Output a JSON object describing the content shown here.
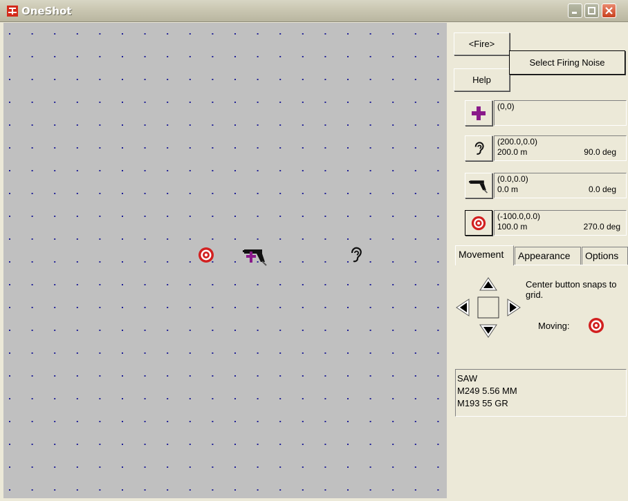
{
  "window": {
    "title": "OneShot"
  },
  "icons": {
    "app": "oneshot-app-icon",
    "crosshair": "crosshair-icon",
    "ear": "ear-icon",
    "gun": "gun-icon",
    "target": "target-icon"
  },
  "colors": {
    "grid_bg": "#c0c0c0",
    "grid_dot": "#1e1e96",
    "target_red": "#d22020",
    "crosshair_purple": "#8a1a8a"
  },
  "toolbar": {
    "fire_label": "<Fire>",
    "help_label": "Help",
    "noise_label": "Select Firing Noise"
  },
  "positions": {
    "origin": {
      "coords": "(0,0)"
    },
    "listener": {
      "coords": "(200.0,0.0)",
      "distance": "200.0 m",
      "angle": "90.0 deg"
    },
    "shooter": {
      "coords": "(0.0,0.0)",
      "distance": "0.0 m",
      "angle": "0.0 deg"
    },
    "target": {
      "coords": "(-100.0,0.0)",
      "distance": "100.0 m",
      "angle": "270.0 deg"
    }
  },
  "tabs": [
    "Movement",
    "Appearance",
    "Options"
  ],
  "movement": {
    "hint": "Center button snaps to grid.",
    "moving_label": "Moving:"
  },
  "weapon": {
    "line1": "SAW",
    "line2": "M249 5.56 MM",
    "line3": "M193 55 GR"
  }
}
